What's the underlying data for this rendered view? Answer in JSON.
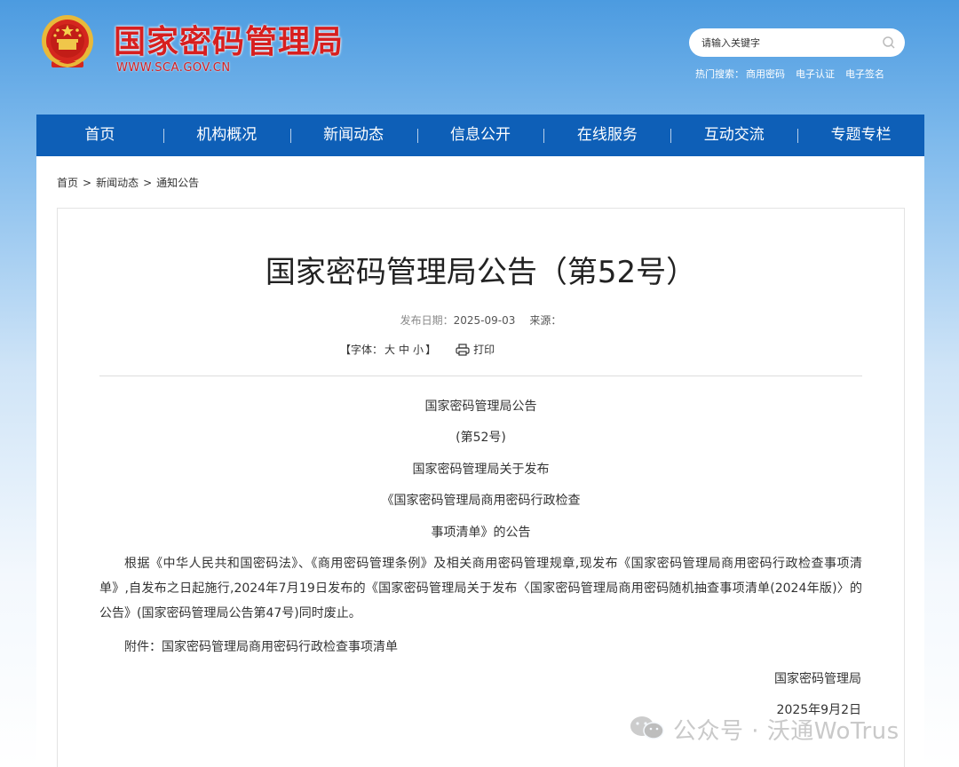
{
  "header": {
    "site_title": "国家密码管理局",
    "site_domain": "WWW.SCA.GOV.CN",
    "search": {
      "placeholder": "请输入关键字"
    },
    "hot_search_label": "热门搜索：",
    "hot_search_items": [
      "商用密码",
      "电子认证",
      "电子签名"
    ]
  },
  "nav": {
    "items": [
      "首页",
      "机构概况",
      "新闻动态",
      "信息公开",
      "在线服务",
      "互动交流",
      "专题专栏"
    ]
  },
  "breadcrumb": {
    "items": [
      "首页",
      "新闻动态",
      "通知公告"
    ],
    "separator": ">"
  },
  "article": {
    "title": "国家密码管理局公告（第52号）",
    "date_label": "发布日期：",
    "date": "2025-09-03",
    "source_label": "来源：",
    "font_label": "【字体：",
    "font_sizes": [
      "大",
      "中",
      "小"
    ],
    "font_close": "】",
    "print_label": "打印",
    "heading_lines": [
      "国家密码管理局公告",
      "(第52号)",
      "国家密码管理局关于发布",
      "《国家密码管理局商用密码行政检查",
      "事项清单》的公告"
    ],
    "paragraph": "根据《中华人民共和国密码法》、《商用密码管理条例》及相关商用密码管理规章,现发布《国家密码管理局商用密码行政检查事项清单》,自发布之日起施行,2024年7月19日发布的《国家密码管理局关于发布〈国家密码管理局商用密码随机抽查事项清单(2024年版)〉的公告》(国家密码管理局公告第47号)同时废止。",
    "attachment": "附件：国家密码管理局商用密码行政检查事项清单",
    "signature": "国家密码管理局",
    "sign_date": "2025年9月2日"
  },
  "watermark": {
    "text": "公众号 · 沃通WoTrus"
  },
  "colors": {
    "nav_bg": "#0e5fb7",
    "title_red": "#d71f1f"
  }
}
